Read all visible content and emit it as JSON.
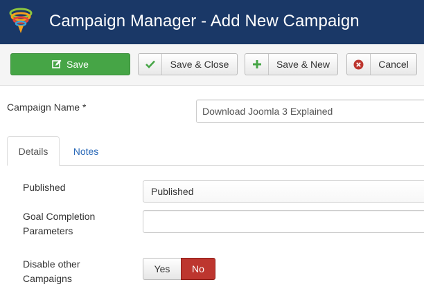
{
  "header": {
    "title": "Campaign Manager - Add New Campaign",
    "logo_icon": "joomla-orbit-logo"
  },
  "toolbar": {
    "save": {
      "label": "Save",
      "icon": "edit-icon"
    },
    "save_close": {
      "label": "Save & Close",
      "icon": "check-icon"
    },
    "save_new": {
      "label": "Save & New",
      "icon": "plus-icon"
    },
    "cancel": {
      "label": "Cancel",
      "icon": "cancel-circle-icon"
    }
  },
  "form": {
    "campaign_name": {
      "label": "Campaign Name *",
      "value": "Download Joomla 3 Explained"
    }
  },
  "tabs": [
    {
      "label": "Details",
      "active": true
    },
    {
      "label": "Notes",
      "active": false
    }
  ],
  "details": {
    "published": {
      "label": "Published",
      "value": "Published"
    },
    "goal_completion": {
      "label": "Goal Completion Parameters",
      "value": ""
    },
    "disable_other": {
      "label": "Disable other Campaigns",
      "options": [
        "Yes",
        "No"
      ],
      "selected": "No"
    }
  },
  "colors": {
    "header_bg": "#1a3867",
    "save_green": "#46a546",
    "no_red": "#bd362f",
    "tab_link": "#2a69b8"
  }
}
